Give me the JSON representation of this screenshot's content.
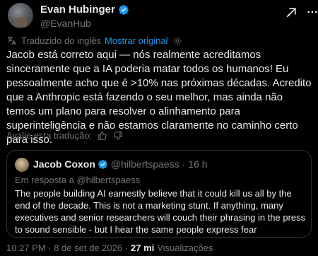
{
  "author": {
    "display_name": "Evan Hubinger",
    "handle": "@EvanHub"
  },
  "translation": {
    "label": "Traduzido do inglês",
    "show_original": "Mostrar original"
  },
  "tweet": {
    "text": "Jacob está correto aqui — nós realmente acreditamos sinceramente que a IA poderia matar todos os humanos! Eu pessoalmente acho que é >10% nas próximas décadas. Acredito que a Anthropic está fazendo o seu melhor, mas ainda não temos um plano para resolver o alinhamento para superinteligência e não estamos claramente no caminho certo para isso."
  },
  "rate": {
    "label": "Avalie esta tradução:"
  },
  "quote": {
    "display_name": "Jacob Coxon",
    "handle": "@hilbertspaess",
    "separator": "·",
    "time": "16 h",
    "reply_prefix": "Em resposta a",
    "reply_handle": "@hilbertspaess",
    "text": "The people building AI earnestly believe that it could kill us all by the end of the decade. This is not a marketing stunt. If anything, many executives and senior researchers will couch their phrasing in the press to sound sensible - but I hear the same people express fear"
  },
  "footer": {
    "timestamp": "10:27 PM · 8 de set de 2026 ·",
    "views_count": "27 mi",
    "views_label": "Visualizações"
  },
  "colors": {
    "background": "#000000",
    "text": "#e7e9ea",
    "muted": "#71767b",
    "accent": "#1d9bf0",
    "border": "#2f3336"
  },
  "icons": {
    "verified": "verified-badge-icon",
    "grok": "grok-icon",
    "more": "more-icon",
    "translate": "translate-icon",
    "gear": "gear-icon",
    "thumb_up": "thumb-up-icon",
    "thumb_down": "thumb-down-icon"
  }
}
